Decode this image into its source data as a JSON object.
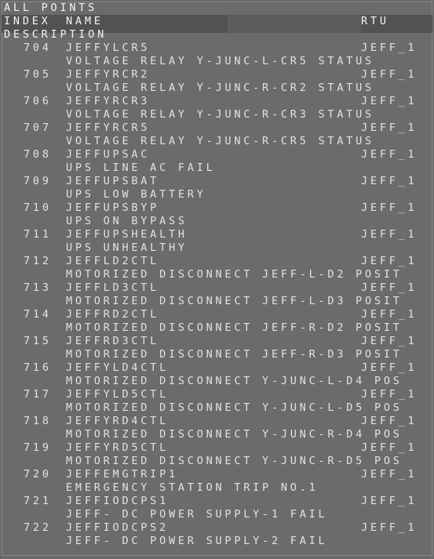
{
  "window": {
    "title": "ALL POINTS"
  },
  "columns": {
    "index": "INDEX",
    "name": "NAME",
    "rtu": "RTU",
    "description": "DESCRIPTION"
  },
  "points": [
    {
      "index": "704",
      "name": "JEFFYLCR5",
      "rtu": "JEFF_1",
      "description": "VOLTAGE RELAY Y-JUNC-L-CR5 STATUS"
    },
    {
      "index": "705",
      "name": "JEFFYRCR2",
      "rtu": "JEFF_1",
      "description": "VOLTAGE RELAY Y-JUNC-R-CR2 STATUS"
    },
    {
      "index": "706",
      "name": "JEFFYRCR3",
      "rtu": "JEFF_1",
      "description": "VOLTAGE RELAY Y-JUNC-R-CR3 STATUS"
    },
    {
      "index": "707",
      "name": "JEFFYRCR5",
      "rtu": "JEFF_1",
      "description": "VOLTAGE RELAY Y-JUNC-R-CR5 STATUS"
    },
    {
      "index": "708",
      "name": "JEFFUPSAC",
      "rtu": "JEFF_1",
      "description": "UPS LINE AC FAIL"
    },
    {
      "index": "709",
      "name": "JEFFUPSBAT",
      "rtu": "JEFF_1",
      "description": "UPS LOW BATTERY"
    },
    {
      "index": "710",
      "name": "JEFFUPSBYP",
      "rtu": "JEFF_1",
      "description": "UPS ON BYPASS"
    },
    {
      "index": "711",
      "name": "JEFFUPSHEALTH",
      "rtu": "JEFF_1",
      "description": "UPS UNHEALTHY"
    },
    {
      "index": "712",
      "name": "JEFFLD2CTL",
      "rtu": "JEFF_1",
      "description": "MOTORIZED DISCONNECT JEFF-L-D2 POSIT"
    },
    {
      "index": "713",
      "name": "JEFFLD3CTL",
      "rtu": "JEFF_1",
      "description": "MOTORIZED DISCONNECT JEFF-L-D3 POSIT"
    },
    {
      "index": "714",
      "name": "JEFFRD2CTL",
      "rtu": "JEFF_1",
      "description": "MOTORIZED DISCONNECT JEFF-R-D2 POSIT"
    },
    {
      "index": "715",
      "name": "JEFFRD3CTL",
      "rtu": "JEFF_1",
      "description": "MOTORIZED DISCONNECT JEFF-R-D3 POSIT"
    },
    {
      "index": "716",
      "name": "JEFFYLD4CTL",
      "rtu": "JEFF_1",
      "description": "MOTORIZED DISCONNECT Y-JUNC-L-D4 POS"
    },
    {
      "index": "717",
      "name": "JEFFYLD5CTL",
      "rtu": "JEFF_1",
      "description": "MOTORIZED DISCONNECT Y-JUNC-L-D5 POS"
    },
    {
      "index": "718",
      "name": "JEFFYRD4CTL",
      "rtu": "JEFF_1",
      "description": "MOTORIZED DISCONNECT Y-JUNC-R-D4 POS"
    },
    {
      "index": "719",
      "name": "JEFFYRD5CTL",
      "rtu": "JEFF_1",
      "description": "MOTORIZED DISCONNECT Y-JUNC-R-D5 POS"
    },
    {
      "index": "720",
      "name": "JEFFEMGTRIP1",
      "rtu": "JEFF_1",
      "description": "EMERGENCY STATION TRIP NO.1"
    },
    {
      "index": "721",
      "name": "JEFFIODCPS1",
      "rtu": "JEFF_1",
      "description": "JEFF- DC POWER SUPPLY-1 FAIL"
    },
    {
      "index": "722",
      "name": "JEFFIODCPS2",
      "rtu": "JEFF_1",
      "description": "JEFF- DC POWER SUPPLY-2 FAIL"
    }
  ],
  "colors": {
    "background": "#6b6b6b",
    "header_band": "#525252",
    "text": "#e2e2e2"
  }
}
